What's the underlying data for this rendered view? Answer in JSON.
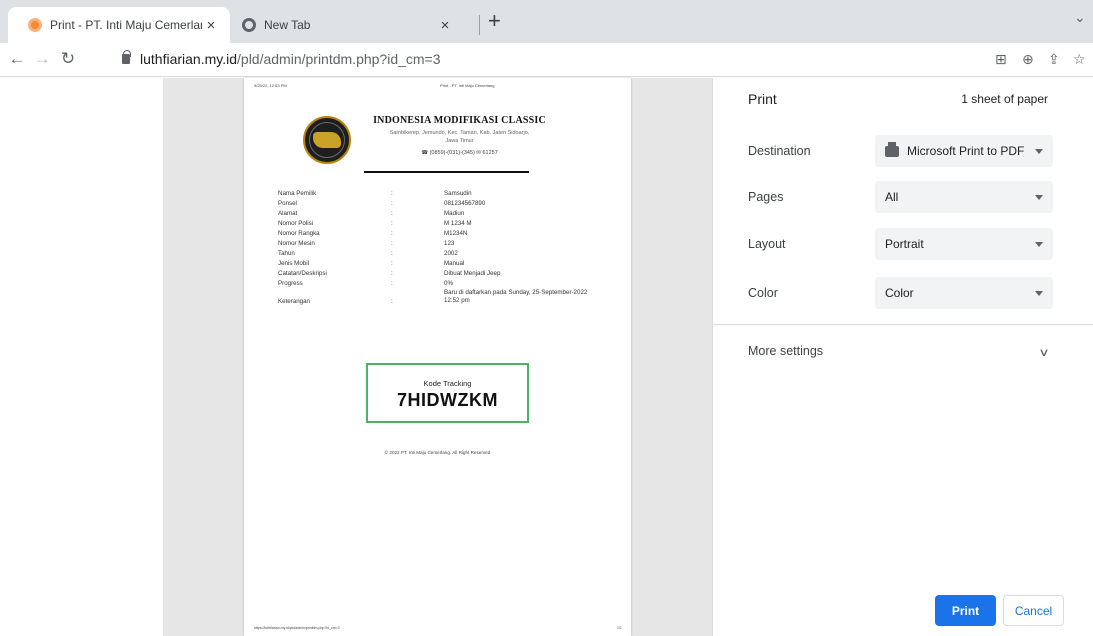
{
  "tabs": [
    {
      "title": "Print - PT. Inti Maju Cemerlang",
      "close": "×"
    },
    {
      "title": "New Tab",
      "close": "×"
    }
  ],
  "toolbar": {
    "url_host": "luthfiarian.my.id",
    "url_path": "/pld/admin/printdm.php?id_cm=3"
  },
  "page_header": {
    "date": "9/25/22, 12:53 PM",
    "doc_title": "Print - PT. Inti Maju Cemerlang"
  },
  "letterhead": {
    "name": "INDONESIA MODIFIKASI CLASSIC",
    "address_line1": "Sambikerep, Jemundo, Kec. Taman, Kab. Jaten Sidoarjo,",
    "address_line2": "Jawa Timur",
    "phone": "☎ (0859)-(031)-(345) ✉ 61257"
  },
  "details": [
    {
      "label": "Nama Pemilik",
      "sep": ":",
      "value": "Samsudin"
    },
    {
      "label": "Ponsel",
      "sep": ":",
      "value": "081234567890"
    },
    {
      "label": "Alamat",
      "sep": ":",
      "value": "Madiun"
    },
    {
      "label": "Nomor Polisi",
      "sep": ":",
      "value": "M 1234 M"
    },
    {
      "label": "Nomor Rangka",
      "sep": ":",
      "value": "M1234N"
    },
    {
      "label": "Nomor Mesin",
      "sep": ":",
      "value": "123"
    },
    {
      "label": "Tahun",
      "sep": ":",
      "value": "2002"
    },
    {
      "label": "Jenis Mobil",
      "sep": ":",
      "value": "Manual"
    },
    {
      "label": "Catatan/Deskripsi",
      "sep": ":",
      "value": "Dibuat Menjadi Jeep"
    },
    {
      "label": "Progress",
      "sep": ":",
      "value": "0%"
    },
    {
      "label": "Keterangan",
      "sep": ":",
      "value": "Baru di daftarkan pada Sunday, 25-September-2022 12:52 pm"
    }
  ],
  "tracking": {
    "label": "Kode Tracking",
    "code": "7HIDWZKM"
  },
  "copyright": "© 2022 PT. Inti Maju Cemerlang. All Right Reserved",
  "page_footer": {
    "url": "https://luthfiarian.my.id/pld/admin/printdm.php?id_cm=3",
    "page": "1/1"
  },
  "print_panel": {
    "title": "Print",
    "sheets": "1 sheet of paper",
    "destination_label": "Destination",
    "destination_value": "Microsoft Print to PDF",
    "pages_label": "Pages",
    "pages_value": "All",
    "layout_label": "Layout",
    "layout_value": "Portrait",
    "color_label": "Color",
    "color_value": "Color",
    "more_settings": "More settings",
    "print_button": "Print",
    "cancel_button": "Cancel"
  },
  "colors": {
    "accent": "#1a73e8",
    "tracking_border": "#49b36a",
    "tabstrip": "#dee1e6"
  }
}
